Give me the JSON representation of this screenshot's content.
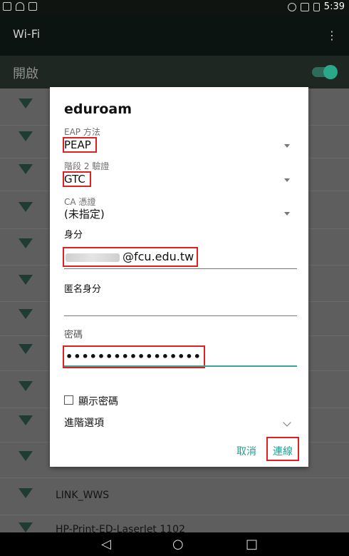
{
  "status_bar": {
    "time": "5:39"
  },
  "app_bar": {
    "title": "Wi-Fi",
    "menu_icon": "more-vert-icon"
  },
  "toggle": {
    "label": "開啟",
    "state": "on"
  },
  "networks": [
    {
      "name": ""
    },
    {
      "name": ""
    },
    {
      "name": ""
    },
    {
      "name": ""
    },
    {
      "name": ""
    },
    {
      "name": ""
    },
    {
      "name": ""
    },
    {
      "name": ""
    },
    {
      "name": ""
    },
    {
      "name": ""
    },
    {
      "name": ""
    },
    {
      "name": "LINK_WWS"
    },
    {
      "name": "HP-Print-ED-LaserJet 1102"
    }
  ],
  "dialog": {
    "title": "eduroam",
    "eap_method": {
      "label": "EAP 方法",
      "value": "PEAP"
    },
    "phase2": {
      "label": "階段 2 驗證",
      "value": "GTC"
    },
    "ca_cert": {
      "label": "CA 憑證",
      "value": "(未指定)"
    },
    "identity": {
      "label": "身分",
      "value": "@fcu.edu.tw"
    },
    "anon_identity": {
      "label": "匿名身分",
      "value": ""
    },
    "password": {
      "label": "密碼",
      "value": "•••••••••••••••••"
    },
    "show_password": {
      "label": "顯示密碼",
      "checked": false
    },
    "advanced": {
      "label": "進階選項"
    },
    "cancel_label": "取消",
    "connect_label": "連線"
  },
  "colors": {
    "accent": "#23a08e",
    "highlight": "#e02020"
  }
}
